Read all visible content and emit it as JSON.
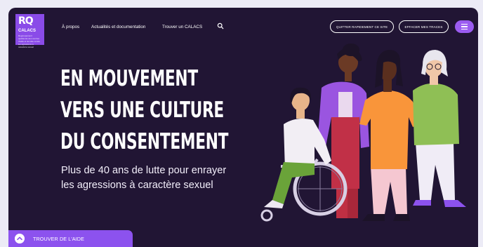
{
  "brand": {
    "logo_main": "RQ",
    "logo_sub": "CALACS",
    "logo_tagline": "Regroupement québécois des centres d'aide et de lutte contre les agressions à caractère sexuel"
  },
  "nav": {
    "items": [
      {
        "label": "À propos"
      },
      {
        "label": "Actualités et documentation"
      },
      {
        "label": "Trouver un CALACS"
      }
    ],
    "search_icon": "search-icon",
    "quit_button": "QUITTER RAPIDEMENT CE SITE",
    "erase_button": "EFFACER MES TRACES",
    "menu_icon": "hamburger-menu-icon"
  },
  "hero": {
    "headline": [
      "EN MOUVEMENT",
      "VERS UNE CULTURE",
      "DU CONSENTEMENT"
    ],
    "subtitle": [
      "Plus de 40 ans de lutte pour enrayer",
      "les agressions à caractère sexuel"
    ]
  },
  "cta": {
    "label": "TROUVER DE L'AIDE",
    "icon": "chevron-up-icon"
  },
  "colors": {
    "background": "#211534",
    "accent": "#8c52ee",
    "text": "#ffffff"
  }
}
